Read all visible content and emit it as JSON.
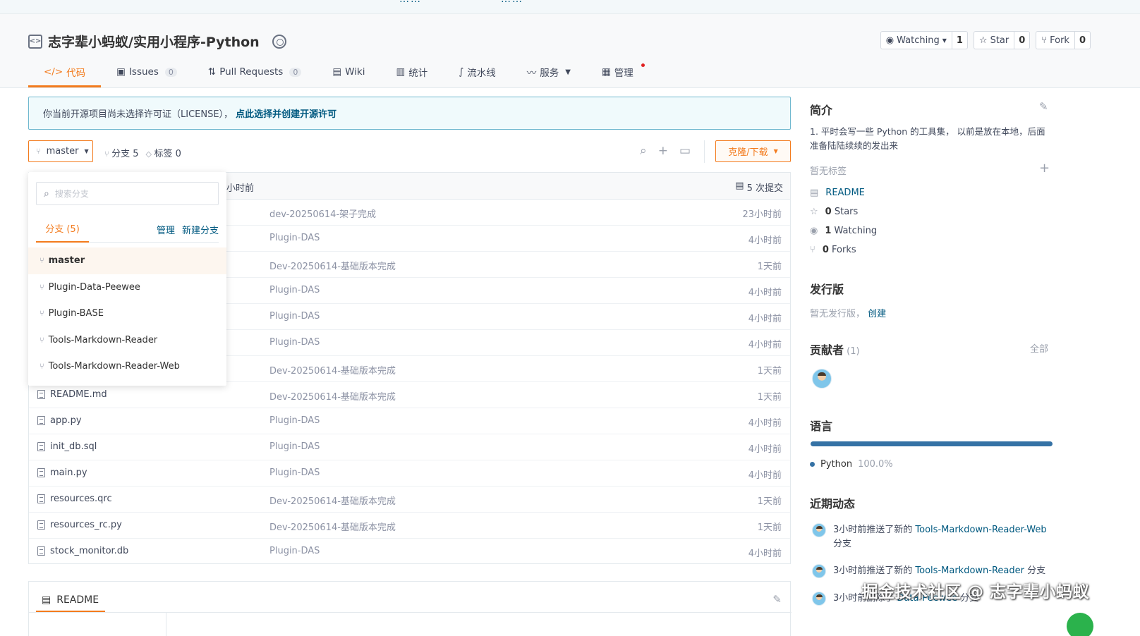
{
  "top_strip": {
    "left_text": "……",
    "right_text": "……"
  },
  "repo": {
    "title": "志字辈小蚂蚁/实用小程序-Python",
    "watching_label": "Watching",
    "watching_count": "1",
    "star_label": "Star",
    "star_count": "0",
    "fork_label": "Fork",
    "fork_count": "0"
  },
  "tabs": [
    {
      "label": "代码",
      "icon": "code-icon"
    },
    {
      "label": "Issues",
      "count": "0",
      "icon": "issues-icon"
    },
    {
      "label": "Pull Requests",
      "count": "0",
      "icon": "pull-request-icon"
    },
    {
      "label": "Wiki",
      "icon": "wiki-icon"
    },
    {
      "label": "统计",
      "icon": "chart-icon"
    },
    {
      "label": "流水线",
      "icon": "pipeline-icon"
    },
    {
      "label": "服务",
      "icon": "service-icon"
    },
    {
      "label": "管理",
      "icon": "manage-icon"
    }
  ],
  "license": {
    "text": "你当前开源项目尚未选择许可证（LICENSE），",
    "link": "点此选择并创建开源许可"
  },
  "branch_bar": {
    "current_branch": "master",
    "branches_label": "分支 5",
    "tags_label": "标签 0",
    "clone_label": "克隆/下载"
  },
  "dropdown": {
    "search_placeholder": "搜索分支",
    "tab_label": "分支 (5)",
    "manage_link": "管理",
    "new_branch_link": "新建分支",
    "branches": [
      "master",
      "Plugin-Data-Peewee",
      "Plugin-BASE",
      "Tools-Markdown-Reader",
      "Tools-Markdown-Reader-Web"
    ]
  },
  "file_table": {
    "last_commit_time": "小时前",
    "commits_label": "5 次提交",
    "rows": [
      {
        "name": "",
        "message": "dev-20250614-架子完成",
        "time": "23小时前"
      },
      {
        "name": "",
        "message": "Plugin-DAS",
        "time": "4小时前"
      },
      {
        "name": "",
        "message": "Dev-20250614-基础版本完成",
        "time": "1天前"
      },
      {
        "name": "",
        "message": "Plugin-DAS",
        "time": "4小时前"
      },
      {
        "name": "",
        "message": "Plugin-DAS",
        "time": "4小时前"
      },
      {
        "name": "",
        "message": "Plugin-DAS",
        "time": "4小时前"
      },
      {
        "name": "",
        "message": "Dev-20250614-基础版本完成",
        "time": "1天前"
      },
      {
        "name": "README.md",
        "message": "Dev-20250614-基础版本完成",
        "time": "1天前"
      },
      {
        "name": "app.py",
        "message": "Plugin-DAS",
        "time": "4小时前"
      },
      {
        "name": "init_db.sql",
        "message": "Plugin-DAS",
        "time": "4小时前"
      },
      {
        "name": "main.py",
        "message": "Plugin-DAS",
        "time": "4小时前"
      },
      {
        "name": "resources.qrc",
        "message": "Dev-20250614-基础版本完成",
        "time": "1天前"
      },
      {
        "name": "resources_rc.py",
        "message": "Dev-20250614-基础版本完成",
        "time": "1天前"
      },
      {
        "name": "stock_monitor.db",
        "message": "Plugin-DAS",
        "time": "4小时前"
      }
    ]
  },
  "readme": {
    "tab_label": "README"
  },
  "sidebar": {
    "intro_title": "简介",
    "intro_text": "1. 平时会写一些 Python 的工具集， 以前是放在本地，后面准备陆陆续续的发出来",
    "no_tags": "暂无标签",
    "readme_link": "README",
    "stars_count": "0",
    "stars_label": "Stars",
    "watching_count": "1",
    "watching_label": "Watching",
    "forks_count": "0",
    "forks_label": "Forks",
    "release_title": "发行版",
    "no_release": "暂无发行版，",
    "create_link": "创建",
    "contributors_title": "贡献者",
    "contributors_count": "(1)",
    "all_link": "全部",
    "language_title": "语言",
    "language_name": "Python",
    "language_percent": "100.0%",
    "language_fraction": 1.0,
    "language_color": "#3572a5",
    "activity_title": "近期动态",
    "activities": [
      {
        "prefix": "3小时前推送了新的",
        "link": "Tools-Markdown-Reader-Web",
        "suffix": "分支"
      },
      {
        "prefix": "3小时前推送了新的",
        "link": "Tools-Markdown-Reader",
        "suffix": "分支"
      },
      {
        "prefix": "3小时前删除了",
        "link": "Data-Peewee",
        "suffix": "分支"
      }
    ]
  },
  "watermark": "掘金技术社区 @ 志字辈小蚂蚁",
  "colors": {
    "accent": "#f37b1d",
    "link": "#005980",
    "python": "#3572a5"
  }
}
